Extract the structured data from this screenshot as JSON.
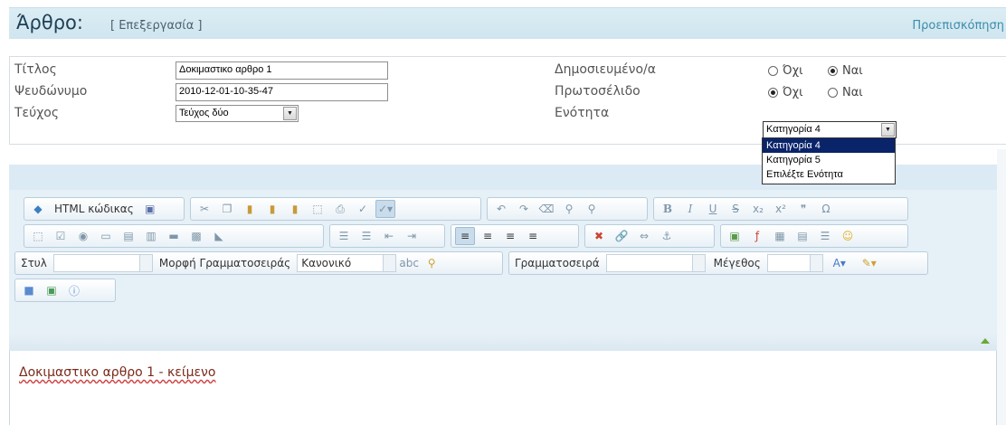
{
  "header": {
    "title": "Άρθρο:",
    "subtitle": "[ Επεξεργασία ]",
    "preview_link": "Προεπισκόπηση"
  },
  "form": {
    "title_label": "Τίτλος",
    "title_value": "Δοκιμαστικο αρθρο 1",
    "alias_label": "Ψευδώνυμο",
    "alias_value": "2010-12-01-10-35-47",
    "issue_label": "Τεύχος",
    "issue_value": "Τεύχος δύο",
    "published_label": "Δημοσιευμένο/α",
    "published_no": "Όχι",
    "published_yes": "Ναι",
    "published_selected": "yes",
    "frontpage_label": "Πρωτοσέλιδο",
    "frontpage_no": "Όχι",
    "frontpage_yes": "Ναι",
    "frontpage_selected": "no",
    "section_label": "Ενότητα",
    "section_value": "Κατηγορία 4",
    "section_options": [
      "Κατηγορία 4",
      "Κατηγορία 5",
      "Επιλέξτε Ενότητα"
    ]
  },
  "toolbar": {
    "html_source": "HTML κώδικας",
    "style_label": "Στυλ",
    "style_value": "",
    "format_label": "Μορφή Γραμματοσειράς",
    "format_value": "Κανονικό",
    "font_label": "Γραμματοσειρά",
    "font_value": "",
    "size_label": "Μέγεθος",
    "size_value": ""
  },
  "editor": {
    "content": "Δοκιμαστικο αρθρο 1 - κείμενο"
  }
}
